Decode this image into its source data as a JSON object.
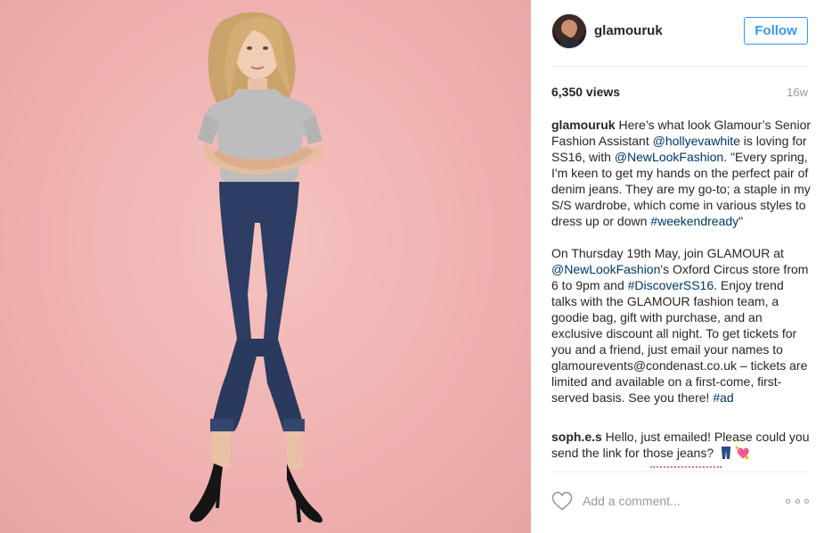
{
  "post": {
    "author": {
      "username": "glamouruk",
      "follow_label": "Follow"
    },
    "stats": {
      "views": "6,350 views",
      "age": "16w"
    },
    "caption": {
      "username": "glamouruk",
      "p1_a": " Here’s what look Glamour’s Senior Fashion Assistant ",
      "mention1": "@hollyevawhite",
      "p1_b": " is loving for SS16, with ",
      "mention2": "@NewLookFashion",
      "p1_c": ". \"Every spring, I'm keen to get my hands on the perfect pair of denim jeans. They are my go-to; a staple in my S/S wardrobe, which come in various styles to dress up or down ",
      "hashtag1": "#weekendready",
      "p1_d": "\"",
      "p2_a": "On Thursday 19th May, join GLAMOUR at ",
      "mention3": "@NewLookFashion",
      "p2_b": "'s Oxford Circus store from 6 to 9pm and ",
      "hashtag2": "#DiscoverSS16",
      "p2_c": ". Enjoy trend talks with the GLAMOUR fashion team, a goodie bag, gift with purchase, and an exclusive discount all night. To get tickets for you and a friend, just email your names to glamourevents@condenast.co.uk – tickets are limited and available on a first-come, first-served basis. See you there! ",
      "hashtag3": "#ad"
    },
    "comments": [
      {
        "username": "soph.e.s",
        "text": " Hello, just emailed! Please could you send the link for those jeans?",
        "emoji": "💘"
      }
    ],
    "add_comment_placeholder": "Add a comment...",
    "icons": {
      "like": "heart-icon",
      "more": "more-options-icon"
    },
    "colors": {
      "link": "#003569",
      "follow": "#3897f0",
      "photo_bg": "#efb2b1"
    }
  }
}
